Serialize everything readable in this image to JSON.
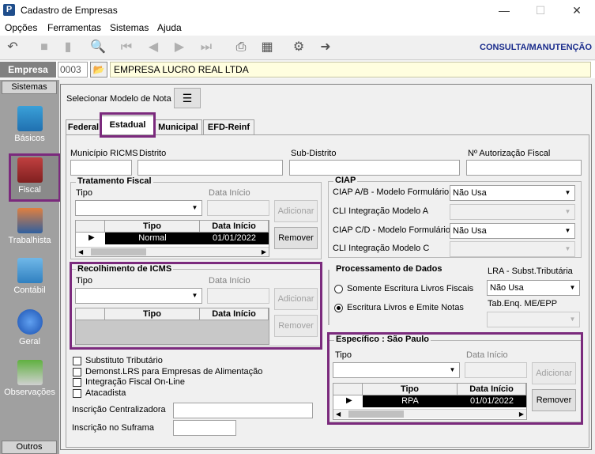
{
  "window": {
    "title": "Cadastro de Empresas"
  },
  "menu": {
    "items": [
      "Opções",
      "Ferramentas",
      "Sistemas",
      "Ajuda"
    ]
  },
  "toolbar": {
    "mode_label": "CONSULTA/MANUTENÇÃO"
  },
  "empresa": {
    "label": "Empresa",
    "code": "0003",
    "name": "EMPRESA LUCRO REAL LTDA"
  },
  "sidebar": {
    "top_header": "Sistemas",
    "bottom_header": "Outros",
    "items": [
      "Básicos",
      "Fiscal",
      "Trabalhista",
      "Contábil",
      "Geral",
      "Observações"
    ]
  },
  "model": {
    "label": "Selecionar Modelo de Nota"
  },
  "tabs": [
    "Federal",
    "Estadual",
    "Municipal",
    "EFD-Reinf"
  ],
  "fields": {
    "municipio": "Município RICMS",
    "distrito": "Distrito",
    "subdistrito": "Sub-Distrito",
    "autorizacao": "Nº Autorização Fiscal"
  },
  "tratamento": {
    "title": "Tratamento Fiscal",
    "tipo": "Tipo",
    "data": "Data Início",
    "add": "Adicionar",
    "remove": "Remover",
    "col_tipo": "Tipo",
    "col_data": "Data Início",
    "row_tipo": "Normal",
    "row_data": "01/01/2022"
  },
  "recolhimento": {
    "title": "Recolhimento de ICMS",
    "tipo": "Tipo",
    "data": "Data Início",
    "add": "Adicionar",
    "remove": "Remover",
    "col_tipo": "Tipo",
    "col_data": "Data Início"
  },
  "checks": [
    "Substituto Tributário",
    "Demonst.LRS para Empresas de Alimentação",
    "Integração Fiscal On-Line",
    "Atacadista"
  ],
  "inscricao": {
    "centralizadora": "Inscrição Centralizadora",
    "suframa": "Inscrição no Suframa"
  },
  "ciap": {
    "title": "CIAP",
    "ab_label": "CIAP  A/B - Modelo Formulário",
    "ab_value": "Não Usa",
    "cli_a": "CLI Integração Modelo A",
    "cd_label": "CIAP C/D - Modelo Formulário",
    "cd_value": "Não Usa",
    "cli_c": "CLI Integração Modelo C"
  },
  "processamento": {
    "title": "Processamento de Dados",
    "opt1": "Somente Escritura Livros Fiscais",
    "opt2": "Escritura Livros e Emite Notas",
    "selected": 2
  },
  "lra": {
    "label": "LRA - Subst.Tributária",
    "value": "Não Usa",
    "tab_label": "Tab.Enq. ME/EPP"
  },
  "especifico": {
    "title": "Específico : São Paulo",
    "tipo": "Tipo",
    "data": "Data Início",
    "add": "Adicionar",
    "remove": "Remover",
    "col_tipo": "Tipo",
    "col_data": "Data Início",
    "row_tipo": "RPA",
    "row_data": "01/01/2022"
  }
}
